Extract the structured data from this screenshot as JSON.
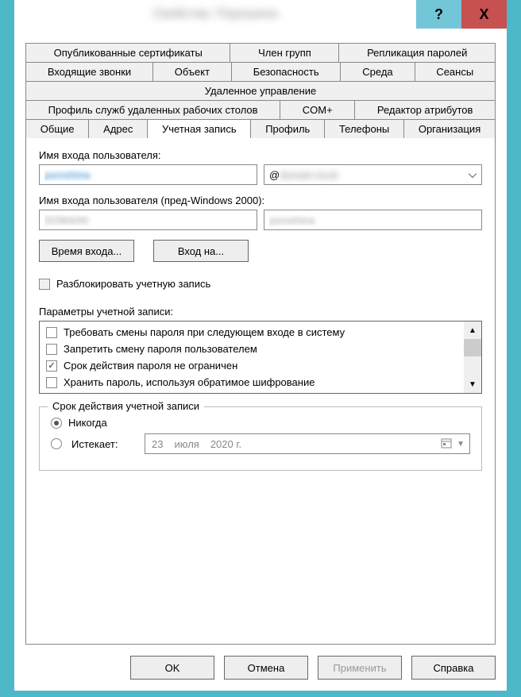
{
  "titlebar": {
    "title": "Свойства: Порошина",
    "help": "?",
    "close": "X"
  },
  "tabs": {
    "published_certs": "Опубликованные сертификаты",
    "member_of": "Член групп",
    "password_replication": "Репликация паролей",
    "dialin": "Входящие звонки",
    "object": "Объект",
    "security": "Безопасность",
    "environment": "Среда",
    "sessions": "Сеансы",
    "remote_control": "Удаленное управление",
    "rds_profile": "Профиль служб удаленных рабочих столов",
    "complus": "COM+",
    "attr_editor": "Редактор атрибутов",
    "general": "Общие",
    "address": "Адрес",
    "account": "Учетная запись",
    "profile": "Профиль",
    "telephones": "Телефоны",
    "organization": "Организация"
  },
  "account": {
    "upn_label": "Имя входа пользователя:",
    "upn_value": "poroshina",
    "upn_suffix_prefix": "@",
    "upn_suffix_value": "domain.local",
    "sam_label": "Имя входа пользователя (пред-Windows 2000):",
    "sam_domain": "DOMAIN\\",
    "sam_user": "poroshina",
    "btn_logon_hours": "Время входа...",
    "btn_log_on_to": "Вход на...",
    "chk_unlock": "Разблокировать учетную запись",
    "options_label": "Параметры учетной записи:",
    "options": [
      {
        "label": "Требовать смены пароля при следующем входе в систему",
        "checked": false
      },
      {
        "label": "Запретить смену пароля пользователем",
        "checked": false
      },
      {
        "label": "Срок действия пароля не ограничен",
        "checked": true
      },
      {
        "label": "Хранить пароль, используя обратимое шифрование",
        "checked": false
      }
    ],
    "expiry": {
      "legend": "Срок действия учетной записи",
      "never": "Никогда",
      "expires": "Истекает:",
      "date_day": "23",
      "date_month": "июля",
      "date_year": "2020 г.",
      "selected": "never"
    }
  },
  "buttons": {
    "ok": "OK",
    "cancel": "Отмена",
    "apply": "Применить",
    "help": "Справка"
  }
}
